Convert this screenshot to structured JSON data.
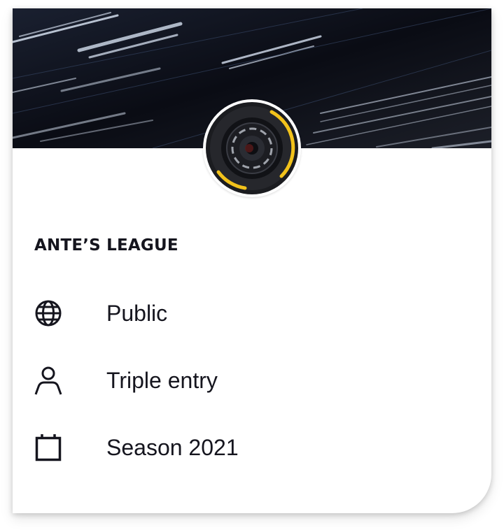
{
  "league": {
    "name": "ANTE’S LEAGUE"
  },
  "details": [
    {
      "icon": "globe-icon",
      "label": "Public"
    },
    {
      "icon": "person-icon",
      "label": "Triple entry"
    },
    {
      "icon": "calendar-icon",
      "label": "Season 2021"
    }
  ],
  "colors": {
    "text": "#15151e",
    "banner_bg": "#0b0d14",
    "tyre_stripe": "#f2c21b"
  }
}
